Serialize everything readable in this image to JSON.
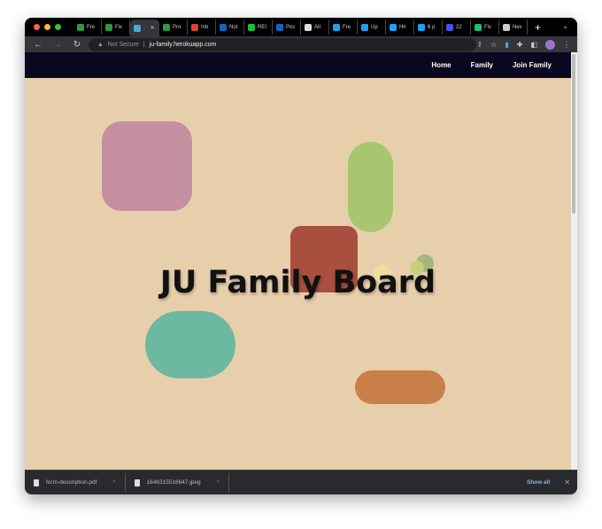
{
  "tabs": [
    {
      "label": "Fre",
      "color": "#2e9a3e"
    },
    {
      "label": "Fix",
      "color": "#2e9a3e"
    },
    {
      "label": ".",
      "color": "#4aa8d8",
      "active": true
    },
    {
      "label": "Pro",
      "color": "#2e9a3e"
    },
    {
      "label": "Inb",
      "color": "#d44638"
    },
    {
      "label": "Not",
      "color": "#0a66c2"
    },
    {
      "label": "REI",
      "color": "#1fbf3a"
    },
    {
      "label": "Pos",
      "color": "#0a66c2"
    },
    {
      "label": "Atl",
      "color": "#ddd"
    },
    {
      "label": "Fre",
      "color": "#1ea0f2"
    },
    {
      "label": "Up",
      "color": "#1ea0f2"
    },
    {
      "label": "Hir",
      "color": "#1ea0f2"
    },
    {
      "label": "6 p",
      "color": "#1ea0f2"
    },
    {
      "label": "22",
      "color": "#4356e0"
    },
    {
      "label": "Fiv",
      "color": "#1dbf73"
    },
    {
      "label": "Nev",
      "color": "#ccc"
    }
  ],
  "address": {
    "security": "Not Secure",
    "url": "ju-family.herokuapp.com"
  },
  "nav": {
    "items": [
      "Home",
      "Family",
      "Join Family"
    ]
  },
  "hero": {
    "title": "JU Family Board"
  },
  "downloads": {
    "items": [
      "form-description.pdf",
      "1646315516647.jpeg"
    ],
    "show_all": "Show all"
  }
}
